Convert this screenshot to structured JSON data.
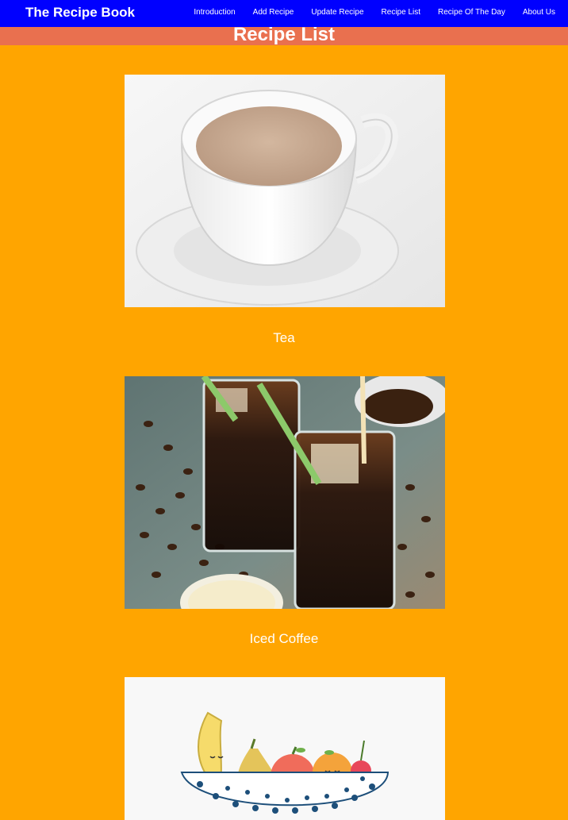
{
  "app": {
    "brand": "The Recipe Book"
  },
  "nav": {
    "items": [
      {
        "label": "Introduction"
      },
      {
        "label": "Add Recipe"
      },
      {
        "label": "Update Recipe"
      },
      {
        "label": "Recipe List"
      },
      {
        "label": "Recipe Of The Day"
      },
      {
        "label": "About Us"
      }
    ]
  },
  "page": {
    "title": "Recipe List"
  },
  "recipes": [
    {
      "name": "Tea",
      "image": "tea-cup-photo"
    },
    {
      "name": "Iced Coffee",
      "image": "iced-coffee-photo"
    },
    {
      "name": "",
      "image": "fruit-bowl-illustration"
    }
  ],
  "colors": {
    "navbar": "#0000FF",
    "title_bar": "#E9704F",
    "page_background": "#FFA500",
    "text": "#FFFFFF"
  }
}
